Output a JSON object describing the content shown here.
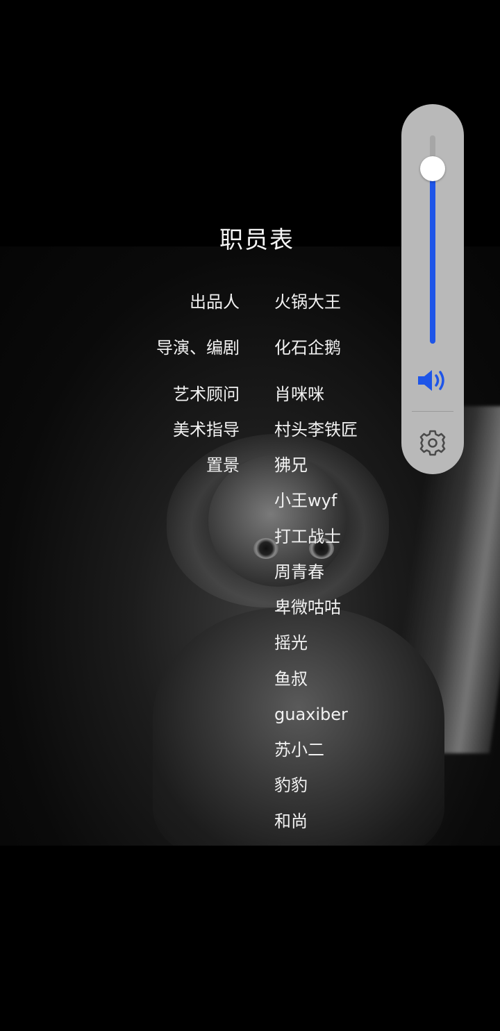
{
  "credits": {
    "title": "职员表",
    "rows": [
      {
        "role": "出品人",
        "name": "火锅大王"
      },
      {
        "role": "导演、编剧",
        "name": "化石企鹅"
      },
      {
        "role": "艺术顾问",
        "name": "肖咪咪"
      },
      {
        "role": "美术指导",
        "name": "村头李铁匠"
      },
      {
        "role": "置景",
        "name": "狒兄"
      },
      {
        "role": "",
        "name": "小王wyf"
      },
      {
        "role": "",
        "name": "打工战士"
      },
      {
        "role": "",
        "name": "周青春"
      },
      {
        "role": "",
        "name": "卑微咕咕"
      },
      {
        "role": "",
        "name": "摇光"
      },
      {
        "role": "",
        "name": "鱼叔"
      },
      {
        "role": "",
        "name": "guaxiber"
      },
      {
        "role": "",
        "name": "苏小二"
      },
      {
        "role": "",
        "name": "豹豹"
      },
      {
        "role": "",
        "name": "和尚"
      }
    ]
  },
  "volume_panel": {
    "level": 0.84,
    "icons": {
      "speaker": "speaker-volume-icon",
      "settings": "gear-icon"
    },
    "colors": {
      "panel": "#b9b9b9",
      "accent": "#1e55e8",
      "icon_gray": "#4a4a4a"
    }
  }
}
